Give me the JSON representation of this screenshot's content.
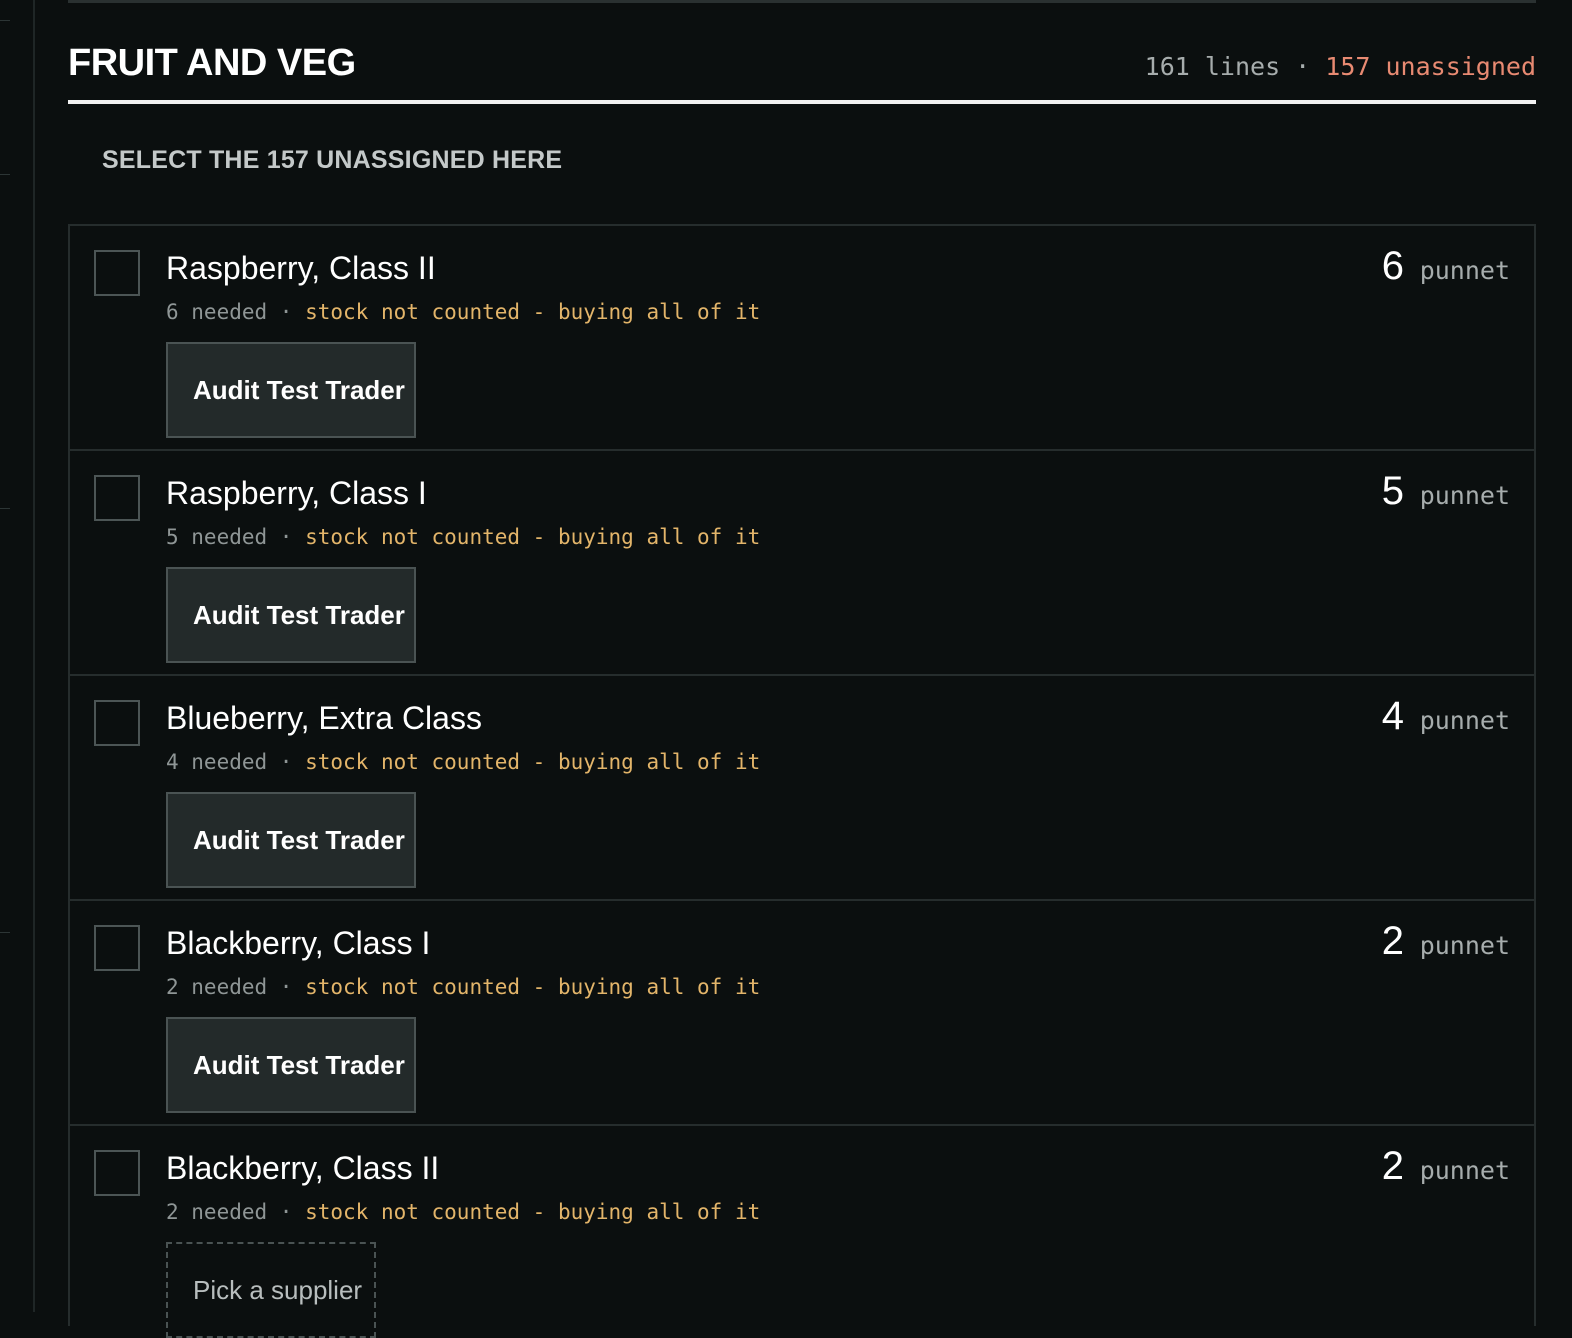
{
  "section": {
    "title": "FRUIT AND VEG",
    "lines_text": "161 lines",
    "separator": " · ",
    "unassigned_text": "157 unassigned"
  },
  "select_link": "SELECT THE 157 UNASSIGNED HERE",
  "items": [
    {
      "name": "Raspberry, Class II",
      "needed": "6 needed",
      "note": "stock not counted - buying all of it",
      "qty": "6",
      "unit": "punnet",
      "supplier": "Audit Test Trader"
    },
    {
      "name": "Raspberry, Class I",
      "needed": "5 needed",
      "note": "stock not counted - buying all of it",
      "qty": "5",
      "unit": "punnet",
      "supplier": "Audit Test Trader"
    },
    {
      "name": "Blueberry, Extra Class",
      "needed": "4 needed",
      "note": "stock not counted - buying all of it",
      "qty": "4",
      "unit": "punnet",
      "supplier": "Audit Test Trader"
    },
    {
      "name": "Blackberry, Class I",
      "needed": "2 needed",
      "note": "stock not counted - buying all of it",
      "qty": "2",
      "unit": "punnet",
      "supplier": "Audit Test Trader"
    },
    {
      "name": "Blackberry, Class II",
      "needed": "2 needed",
      "note": "stock not counted - buying all of it",
      "qty": "2",
      "unit": "punnet",
      "supplier_placeholder": "Pick a supplier"
    }
  ],
  "colors": {
    "background": "#0b0f0f",
    "accent_unassigned": "#e88a72",
    "note_amber": "#e3b56a"
  }
}
